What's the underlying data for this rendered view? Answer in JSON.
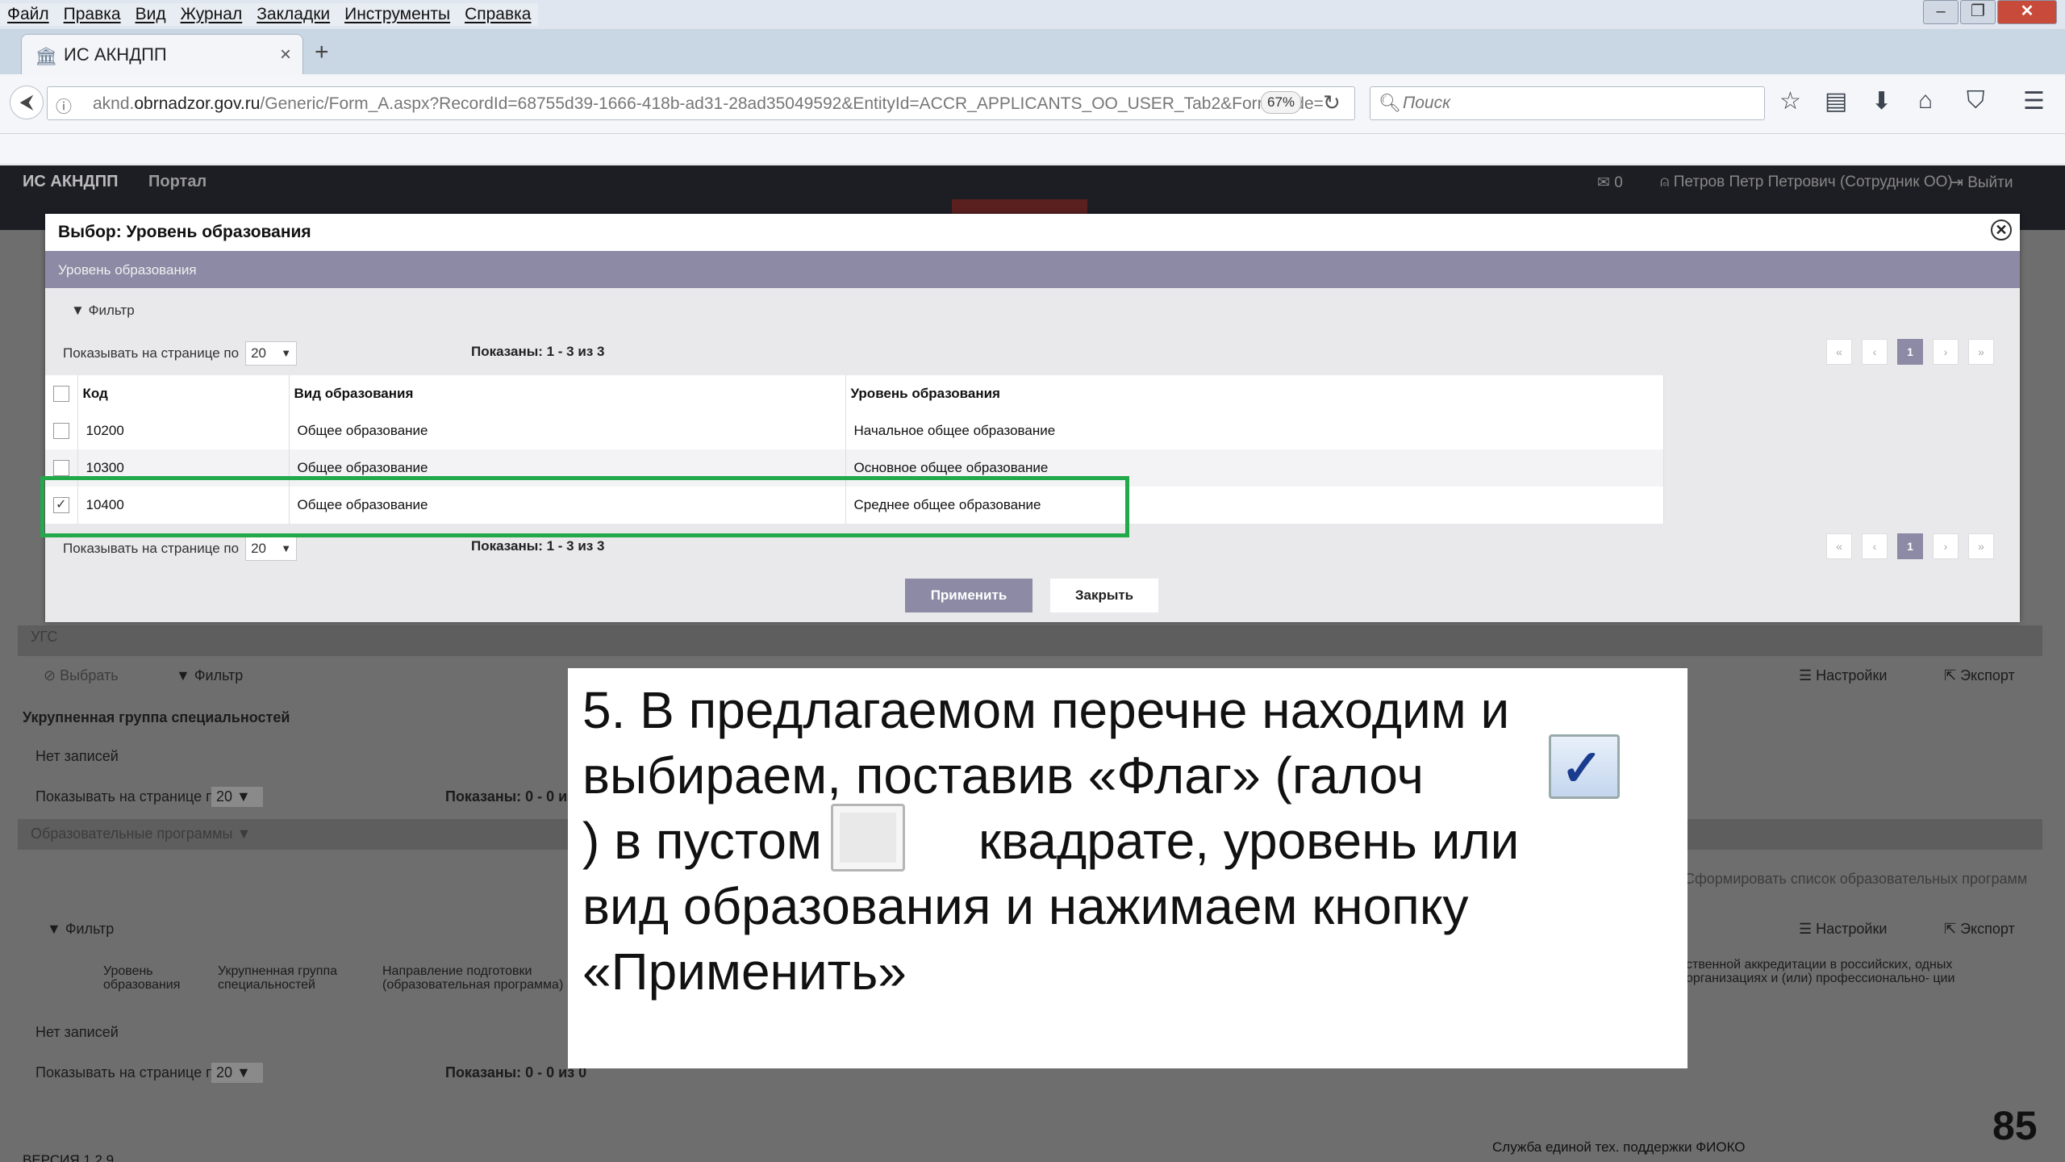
{
  "menu": [
    "Файл",
    "Правка",
    "Вид",
    "Журнал",
    "Закладки",
    "Инструменты",
    "Справка"
  ],
  "tab": {
    "title": "ИС АКНДПП",
    "close": "×",
    "new": "+"
  },
  "address": {
    "domain_pre": "aknd.",
    "domain": "obrnadzor.gov.ru",
    "path": "/Generic/Form_A.aspx?RecordId=68755d39-1666-418b-ad31-28ad35049592&EntityId=ACCR_APPLICANTS_OO_USER_Tab2&FormMode=",
    "zoom": "67%"
  },
  "search": {
    "placeholder": "Поиск"
  },
  "app": {
    "brand": "ИС АКНДПП",
    "portal": "Портал",
    "messages": "0",
    "user": "Петров Петр Петрович (Сотрудник ОО)",
    "logout": "Выйти"
  },
  "background": {
    "ugs": "УГС",
    "select": "Выбрать",
    "filter": "Фильтр",
    "settings": "Настройки",
    "export": "Экспорт",
    "ugs_header": "Укрупненная группа специальностей",
    "no_records": "Нет записей",
    "per_page": "Показывать на странице по",
    "per_page_value": "20",
    "shown_zero": "Показаны: 0 - 0 из 0",
    "programs": "Образовательные программы",
    "form_list": "Сформировать список образовательных программ",
    "col1": "Уровень образования",
    "col2": "Укрупненная группа специальностей",
    "col3": "Направление подготовки (образовательная программа)",
    "col_right": "ственной аккредитации в российских, одных организациях и (или) профессионально- ции",
    "support": "Служба единой тех. поддержки ФИОКО",
    "version": "ВЕРСИЯ 1.2.9"
  },
  "modal": {
    "title": "Выбор: Уровень образования",
    "section": "Уровень образования",
    "filter": "Фильтр",
    "per_page": "Показывать на странице по",
    "per_page_value": "20",
    "shown": "Показаны: 1 - 3 из 3",
    "page": "1",
    "columns": [
      "Код",
      "Вид образования",
      "Уровень образования"
    ],
    "rows": [
      {
        "code": "10200",
        "kind": "Общее образование",
        "level": "Начальное общее образование",
        "checked": false
      },
      {
        "code": "10300",
        "kind": "Общее образование",
        "level": "Основное общее образование",
        "checked": false
      },
      {
        "code": "10400",
        "kind": "Общее образование",
        "level": "Среднее общее образование",
        "checked": true
      }
    ],
    "apply": "Применить",
    "close": "Закрыть"
  },
  "callout": {
    "line1": "5. В предлагаемом перечне находим и",
    "line2": "выбираем, поставив «Флаг» (галоч",
    "line3a": ") в пустом",
    "line3b": "квадрате, уровень или",
    "line4": "вид образования и нажимаем кнопку",
    "line5": "«Применить»"
  },
  "slide_number": "85",
  "colors": {
    "accent": "#8c8aa5",
    "highlight": "#22a94a",
    "appbar": "#1d1d24"
  }
}
